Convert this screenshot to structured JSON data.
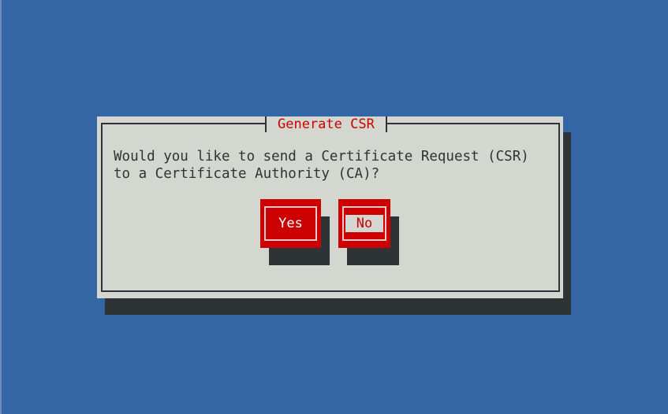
{
  "dialog": {
    "title": "Generate CSR",
    "message_line1": "Would you like to send a Certificate Request (CSR)",
    "message_line2": "to a Certificate Authority (CA)?",
    "yes_label": "Yes",
    "no_label": "No"
  },
  "colors": {
    "background": "#3465a4",
    "dialog": "#d3d7cf",
    "accent": "#cc0000",
    "shadow": "#2e3436"
  }
}
